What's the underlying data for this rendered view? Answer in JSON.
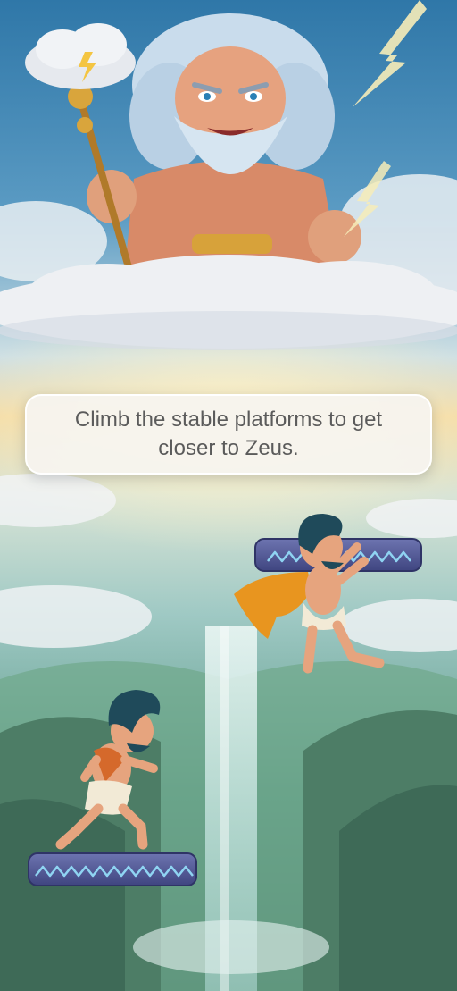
{
  "tutorial": {
    "message": "Climb the stable platforms to get closer to Zeus."
  },
  "colors": {
    "sky_top": "#3f86b4",
    "sky_mid": "#a9cfd9",
    "sunset_glow": "#f3d79a",
    "valley_green": "#5f9a6e",
    "platform_stone": "#4f5592",
    "platform_rune": "#8fd4f2",
    "cape_orange": "#e8951f",
    "hair_dark": "#1f4a5a",
    "zeus_beard": "#d8e6f2",
    "lightning": "#f6e7a0"
  },
  "characters": {
    "god": "zeus-with-thunder-staff",
    "hero_left": "running-hero",
    "hero_right": "jumping-hero"
  },
  "platforms": {
    "upper": "rune-platform",
    "lower": "rune-platform"
  }
}
